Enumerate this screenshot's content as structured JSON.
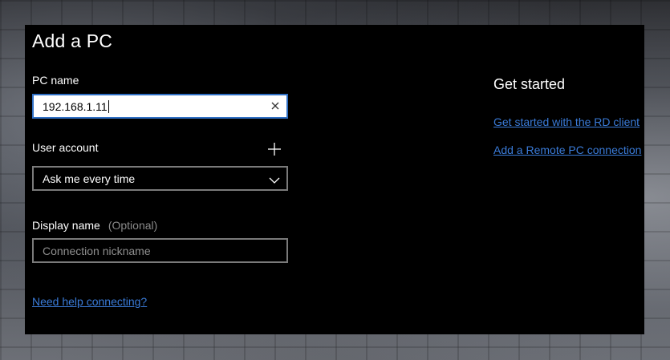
{
  "page": {
    "title": "Add a PC"
  },
  "form": {
    "pc_name": {
      "label": "PC name",
      "value": "192.168.1.11"
    },
    "user_account": {
      "label": "User account",
      "selected": "Ask me every time"
    },
    "display_name": {
      "label": "Display name",
      "optional": "(Optional)",
      "placeholder": "Connection nickname"
    },
    "help_link": "Need help connecting?"
  },
  "sidebar": {
    "title": "Get started",
    "links": [
      "Get started with the RD client",
      "Add a Remote PC connection"
    ]
  },
  "icons": {
    "clear": "close-icon",
    "add_user": "plus-icon",
    "dropdown": "chevron-down-icon"
  },
  "colors": {
    "accent": "#2f6fc4",
    "link": "#3a7bd8",
    "panel": "#000000",
    "muted": "#8a8a8a"
  }
}
